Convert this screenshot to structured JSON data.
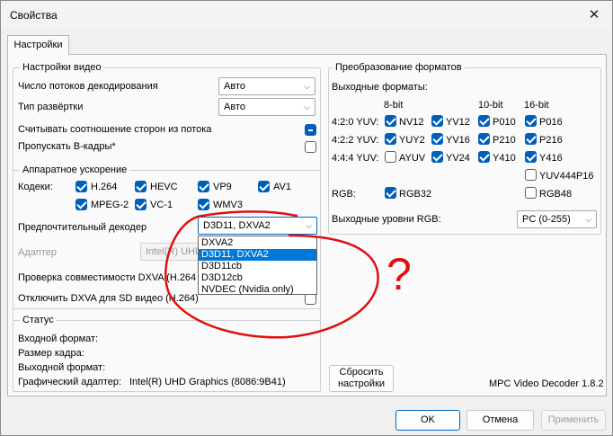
{
  "window": {
    "title": "Свойства"
  },
  "tab": "Настройки",
  "video": {
    "legend": "Настройки видео",
    "threads_label": "Число потоков декодирования",
    "threads_value": "Авто",
    "deint_label": "Тип развёртки",
    "deint_value": "Авто",
    "aspect_label": "Считывать соотношение сторон из потока",
    "skip_b_label": "Пропускать B-кадры*"
  },
  "hw": {
    "legend": "Аппаратное ускорение",
    "codecs_label": "Кодеки:",
    "codecs": [
      {
        "label": "H.264",
        "checked": true
      },
      {
        "label": "HEVC",
        "checked": true
      },
      {
        "label": "VP9",
        "checked": true
      },
      {
        "label": "AV1",
        "checked": true
      },
      {
        "label": "MPEG-2",
        "checked": true
      },
      {
        "label": "VC-1",
        "checked": true
      },
      {
        "label": "WMV3",
        "checked": true
      }
    ],
    "decoder_label": "Предпочтительный декодер",
    "decoder_value": "D3D11, DXVA2",
    "decoder_options": [
      "DXVA2",
      "D3D11, DXVA2",
      "D3D11cb",
      "D3D12cb",
      "NVDEC (Nvidia only)"
    ],
    "selected_option_index": 1,
    "adapter_label": "Адаптер",
    "adapter_value": "Intel(R) UHD",
    "dxva_check_label": "Проверка совместимости DXVA (H.264",
    "dxva_sd_label": "Отключить DXVA для SD видео (H.264)"
  },
  "status": {
    "legend": "Статус",
    "input_label": "Входной формат:",
    "frame_label": "Размер кадра:",
    "output_label": "Выходной формат:",
    "adapter_label": "Графический адаптер:",
    "adapter_value": "Intel(R) UHD Graphics (8086:9B41)"
  },
  "formats": {
    "legend": "Преобразование форматов",
    "output_label": "Выходные форматы:",
    "bit_headers": [
      "8-bit",
      "10-bit",
      "16-bit"
    ],
    "rows": [
      {
        "label": "4:2:0 YUV:",
        "items": [
          {
            "label": "NV12",
            "checked": true
          },
          {
            "label": "YV12",
            "checked": true
          },
          {
            "label": "P010",
            "checked": true
          },
          {
            "label": "P016",
            "checked": true
          }
        ]
      },
      {
        "label": "4:2:2 YUV:",
        "items": [
          {
            "label": "YUY2",
            "checked": true
          },
          {
            "label": "YV16",
            "checked": true
          },
          {
            "label": "P210",
            "checked": true
          },
          {
            "label": "P216",
            "checked": true
          }
        ]
      },
      {
        "label": "4:4:4 YUV:",
        "items": [
          {
            "label": "AYUV",
            "checked": false
          },
          {
            "label": "YV24",
            "checked": true
          },
          {
            "label": "Y410",
            "checked": true
          },
          {
            "label": "Y416",
            "checked": true
          }
        ]
      }
    ],
    "yuv444p16": {
      "label": "YUV444P16",
      "checked": false
    },
    "rgb_label": "RGB:",
    "rgb32": {
      "label": "RGB32",
      "checked": true
    },
    "rgb48": {
      "label": "RGB48",
      "checked": false
    },
    "levels_label": "Выходные уровни RGB:",
    "levels_value": "PC (0-255)"
  },
  "reset_button": {
    "line1": "Сбросить",
    "line2": "настройки"
  },
  "version": "MPC Video Decoder 1.8.2",
  "buttons": {
    "ok": "OK",
    "cancel": "Отмена",
    "apply": "Применить"
  },
  "annotation": {
    "text": "?",
    "color": "#e01010"
  }
}
